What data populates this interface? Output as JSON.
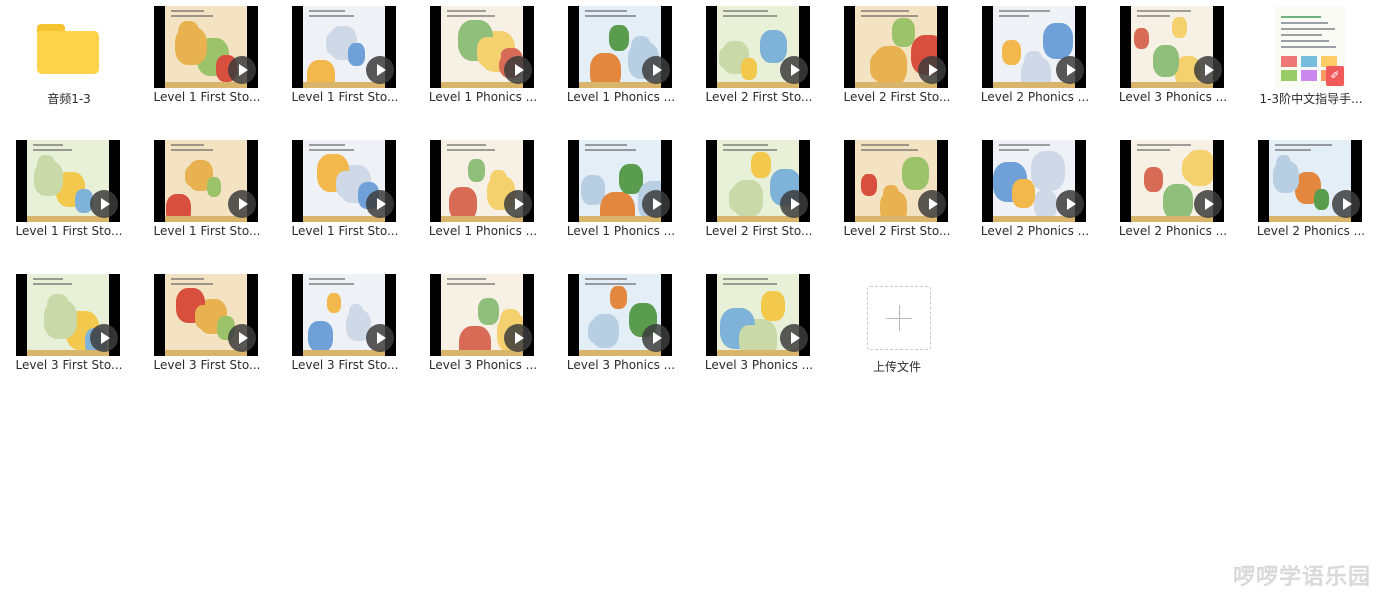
{
  "files": [
    {
      "name": "音频1-3",
      "type": "folder",
      "icon": "folder-icon"
    },
    {
      "name": "Level 1 First Sto...",
      "type": "video",
      "icon": "play-icon"
    },
    {
      "name": "Level 1 First Sto...",
      "type": "video",
      "icon": "play-icon"
    },
    {
      "name": "Level 1 Phonics ...",
      "type": "video",
      "icon": "play-icon"
    },
    {
      "name": "Level 1 Phonics ...",
      "type": "video",
      "icon": "play-icon"
    },
    {
      "name": "Level 2 First Sto...",
      "type": "video",
      "icon": "play-icon"
    },
    {
      "name": "Level 2 First Sto...",
      "type": "video",
      "icon": "play-icon"
    },
    {
      "name": "Level 2 Phonics ...",
      "type": "video",
      "icon": "play-icon"
    },
    {
      "name": "Level 3 Phonics ...",
      "type": "video",
      "icon": "play-icon"
    },
    {
      "name": "1-3阶中文指导手...",
      "type": "pdf",
      "icon": "pdf-icon"
    },
    {
      "name": "Level 1 First Sto...",
      "type": "video",
      "icon": "play-icon"
    },
    {
      "name": "Level 1 First Sto...",
      "type": "video",
      "icon": "play-icon"
    },
    {
      "name": "Level 1 First Sto...",
      "type": "video",
      "icon": "play-icon"
    },
    {
      "name": "Level 1 Phonics ...",
      "type": "video",
      "icon": "play-icon"
    },
    {
      "name": "Level 1 Phonics ...",
      "type": "video",
      "icon": "play-icon"
    },
    {
      "name": "Level 2 First Sto...",
      "type": "video",
      "icon": "play-icon"
    },
    {
      "name": "Level 2 First Sto...",
      "type": "video",
      "icon": "play-icon"
    },
    {
      "name": "Level 2 Phonics ...",
      "type": "video",
      "icon": "play-icon"
    },
    {
      "name": "Level 2 Phonics ...",
      "type": "video",
      "icon": "play-icon"
    },
    {
      "name": "Level 2 Phonics ...",
      "type": "video",
      "icon": "play-icon"
    },
    {
      "name": "Level 3 First Sto...",
      "type": "video",
      "icon": "play-icon"
    },
    {
      "name": "Level 3 First Sto...",
      "type": "video",
      "icon": "play-icon"
    },
    {
      "name": "Level 3 First Sto...",
      "type": "video",
      "icon": "play-icon"
    },
    {
      "name": "Level 3 Phonics ...",
      "type": "video",
      "icon": "play-icon"
    },
    {
      "name": "Level 3 Phonics ...",
      "type": "video",
      "icon": "play-icon"
    },
    {
      "name": "Level 3 Phonics ...",
      "type": "video",
      "icon": "play-icon"
    }
  ],
  "upload": {
    "label": "上传文件",
    "icon": "plus-icon"
  },
  "watermark": "啰啰学语乐园",
  "colors": {
    "folder": "#fcd34a",
    "pdf_badge": "#f15a5a",
    "label_text": "#2b2b2b"
  }
}
